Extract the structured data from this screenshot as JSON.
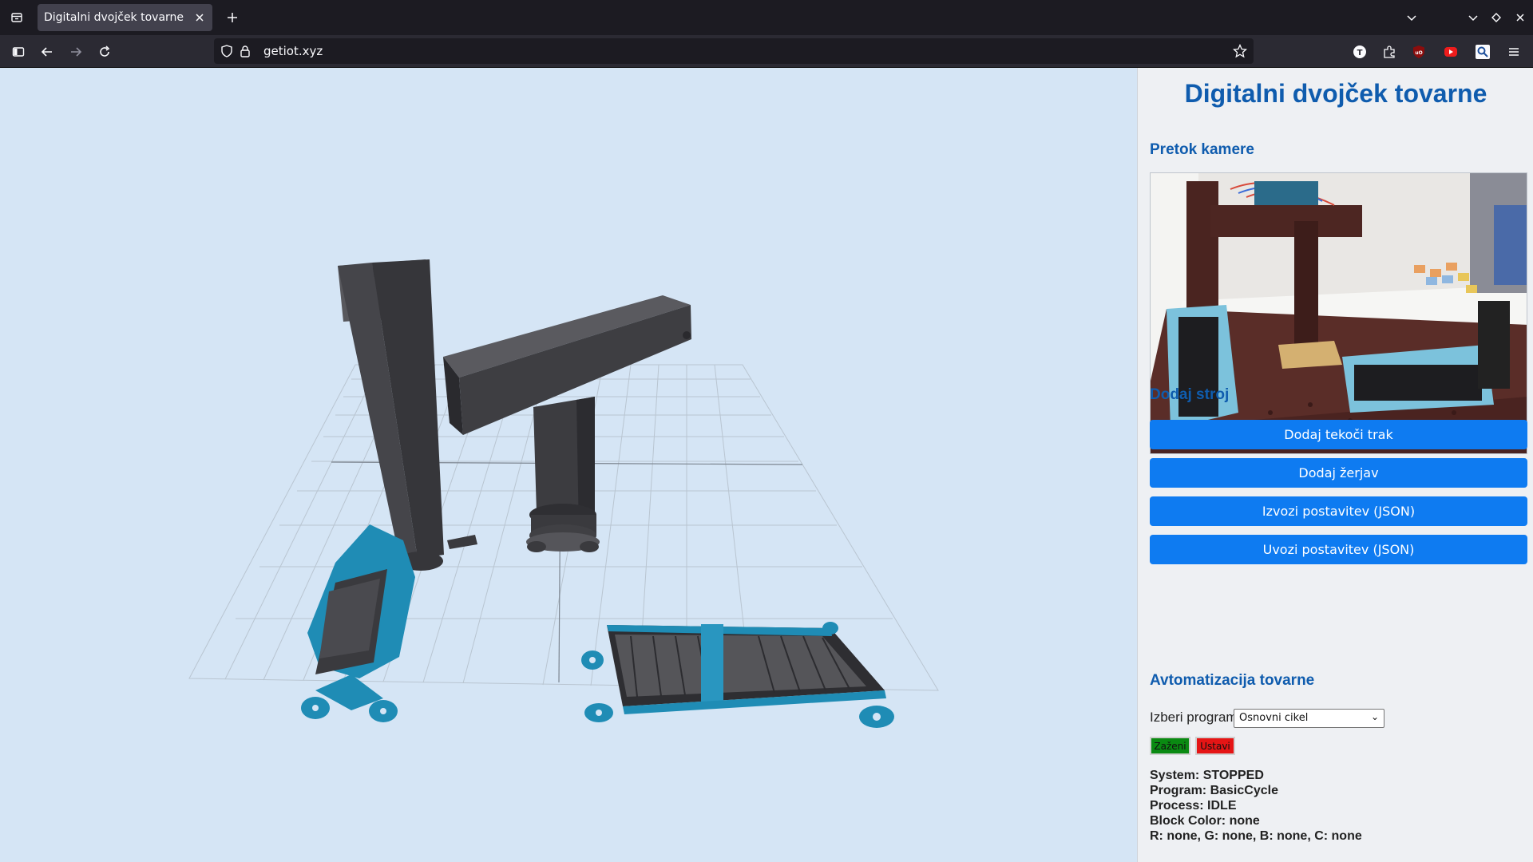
{
  "browser": {
    "tab_title": "Digitalni dvojček tovarne",
    "url": "getiot.xyz"
  },
  "page": {
    "title": "Digitalni dvojček tovarne",
    "camera_heading": "Pretok kamere",
    "add_machine_heading": "Dodaj stroj",
    "buttons": {
      "add_conveyor": "Dodaj tekoči trak",
      "add_crane": "Dodaj žerjav",
      "export_layout": "Izvozi postavitev (JSON)",
      "import_layout": "Uvozi postavitev (JSON)"
    },
    "automation_heading": "Avtomatizacija tovarne",
    "program_label": "Izberi program:",
    "program_selected": "Osnovni cikel",
    "start_label": "Zaženi",
    "stop_label": "Ustavi",
    "status": {
      "system": "System: STOPPED",
      "program": "Program: BasicCycle",
      "process": "Process: IDLE",
      "block_color": "Block Color: none",
      "rgbc": "R: none, G: none, B: none, C: none"
    }
  },
  "colors": {
    "accent": "#0f5cae",
    "button_blue": "#0e7bf1",
    "start_green": "#0a8a12",
    "stop_red": "#e51515",
    "viewport_bg": "#d5e5f5",
    "machine_dark": "#444448",
    "machine_blue": "#1e8fb8"
  },
  "icons": {
    "tab_list": "tab-list-icon",
    "back": "back-arrow-icon",
    "forward": "forward-arrow-icon",
    "reload": "reload-icon",
    "bookmark": "star-icon"
  }
}
